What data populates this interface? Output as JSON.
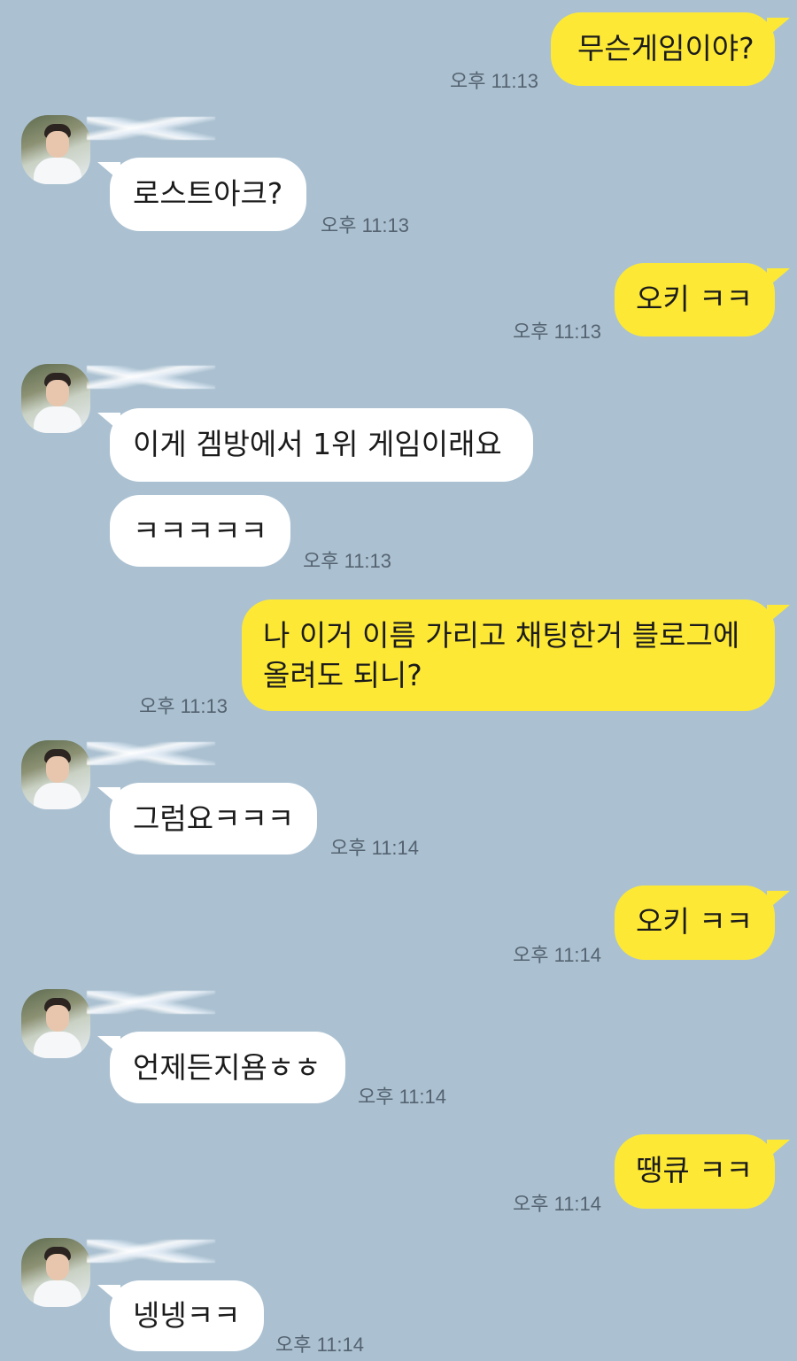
{
  "messages": [
    {
      "from": "me",
      "text": "무슨게임이야?",
      "time": "오후 11:13"
    },
    {
      "from": "them",
      "text": "로스트아크?",
      "time": "오후 11:13"
    },
    {
      "from": "me",
      "text": "오키 ㅋㅋ",
      "time": "오후 11:13"
    },
    {
      "from": "them",
      "text": "이게 겜방에서 1위 게임이래요",
      "time": ""
    },
    {
      "from": "them",
      "text": "ㅋㅋㅋㅋㅋ",
      "time": "오후 11:13"
    },
    {
      "from": "me",
      "text": "나 이거 이름 가리고 채팅한거 블로그에",
      "text2": "올려도 되니?",
      "time": "오후 11:13"
    },
    {
      "from": "them",
      "text": "그럼요ㅋㅋㅋ",
      "time": "오후 11:14"
    },
    {
      "from": "me",
      "text": "오키 ㅋㅋ",
      "time": "오후 11:14"
    },
    {
      "from": "them",
      "text": "언제든지욤ㅎㅎ",
      "time": "오후 11:14"
    },
    {
      "from": "me",
      "text": "땡큐 ㅋㅋ",
      "time": "오후 11:14"
    },
    {
      "from": "them",
      "text": "넹넹ㅋㅋ",
      "time": "오후 11:14"
    }
  ],
  "colors": {
    "background": "#abc1d1",
    "my_bubble": "#fde935",
    "their_bubble": "#ffffff",
    "timestamp": "#556371"
  }
}
